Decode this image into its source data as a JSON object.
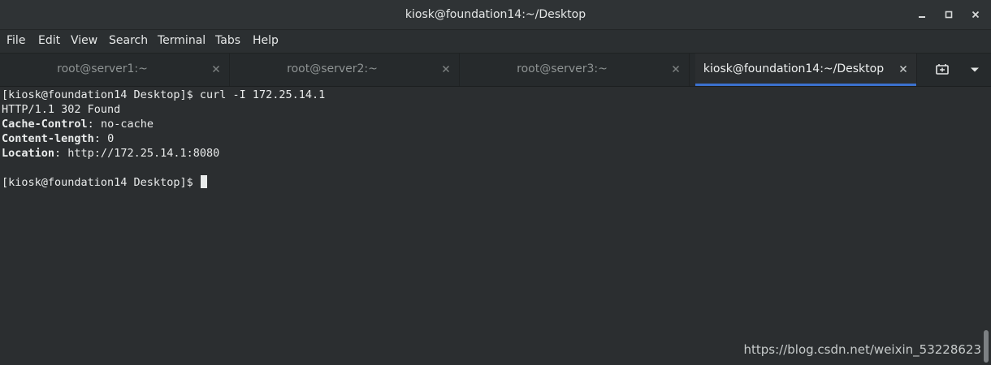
{
  "window": {
    "title": "kiosk@foundation14:~/Desktop",
    "controls": [
      "minimize-icon",
      "maximize-icon",
      "close-icon"
    ]
  },
  "menubar": {
    "items": [
      "File",
      "Edit",
      "View",
      "Search",
      "Terminal",
      "Tabs",
      "Help"
    ]
  },
  "tabs": [
    {
      "label": "root@server1:~",
      "active": false
    },
    {
      "label": "root@server2:~",
      "active": false
    },
    {
      "label": "root@server3:~",
      "active": false
    },
    {
      "label": "kiosk@foundation14:~/Desktop",
      "active": true
    }
  ],
  "tab_tools": [
    "new-tab-icon",
    "tab-menu-chevron-icon"
  ],
  "terminal": {
    "prompt": "[kiosk@foundation14 Desktop]$",
    "command": "curl -I 172.25.14.1",
    "status_line": "HTTP/1.1 302 Found",
    "headers": [
      {
        "key": "Cache-Control",
        "value": "no-cache"
      },
      {
        "key": "Content-length",
        "value": "0"
      },
      {
        "key": "Location",
        "value": "http://172.25.14.1:8080"
      }
    ],
    "second_prompt": "[kiosk@foundation14 Desktop]$"
  },
  "watermark": "https://blog.csdn.net/weixin_53228623",
  "colors": {
    "terminal_bg": "#2b2e30",
    "accent": "#3b71ce",
    "text": "#e9ebeb"
  }
}
